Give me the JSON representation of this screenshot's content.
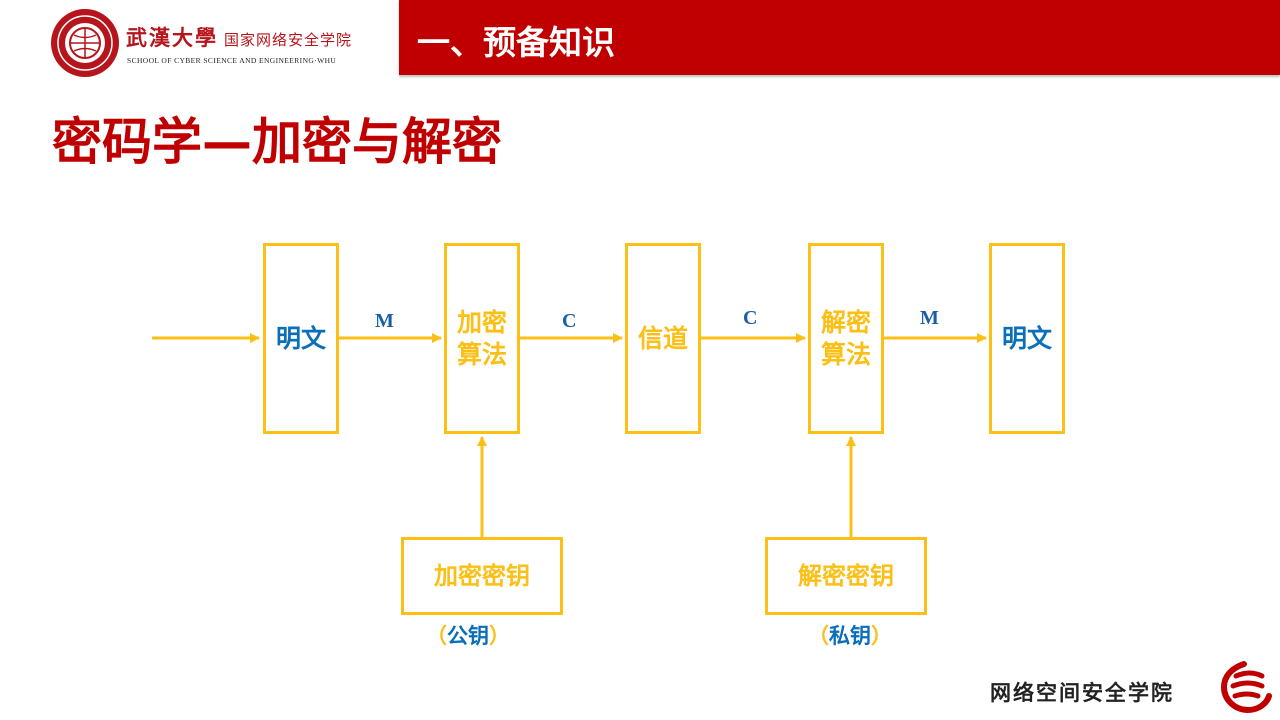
{
  "header": {
    "school_name_cn": "武漢大學",
    "school_dept_cn": "国家网络安全学院",
    "school_name_en": "SCHOOL OF CYBER SCIENCE AND ENGINEERING·WHU",
    "section_title": "一、预备知识"
  },
  "page_title": "密码学—加密与解密",
  "diagram": {
    "boxes": {
      "plaintext_in": "明文",
      "enc_algo_line1": "加密",
      "enc_algo_line2": "算法",
      "channel": "信道",
      "dec_algo_line1": "解密",
      "dec_algo_line2": "算法",
      "plaintext_out": "明文",
      "enc_key": "加密密钥",
      "dec_key": "解密密钥"
    },
    "arrow_labels": {
      "m1": "M",
      "c1": "C",
      "c2": "C",
      "m2": "M"
    },
    "notes": {
      "enc_key_open": "（",
      "enc_key_type": "公钥",
      "enc_key_close": "）",
      "dec_key_open": "（",
      "dec_key_type": "私钥",
      "dec_key_close": "）"
    }
  },
  "footer": {
    "college_name": "网络空间安全学院"
  },
  "colors": {
    "brand_red": "#c00000",
    "box_border": "#fbbf15",
    "text_blue": "#0a6fb8"
  }
}
